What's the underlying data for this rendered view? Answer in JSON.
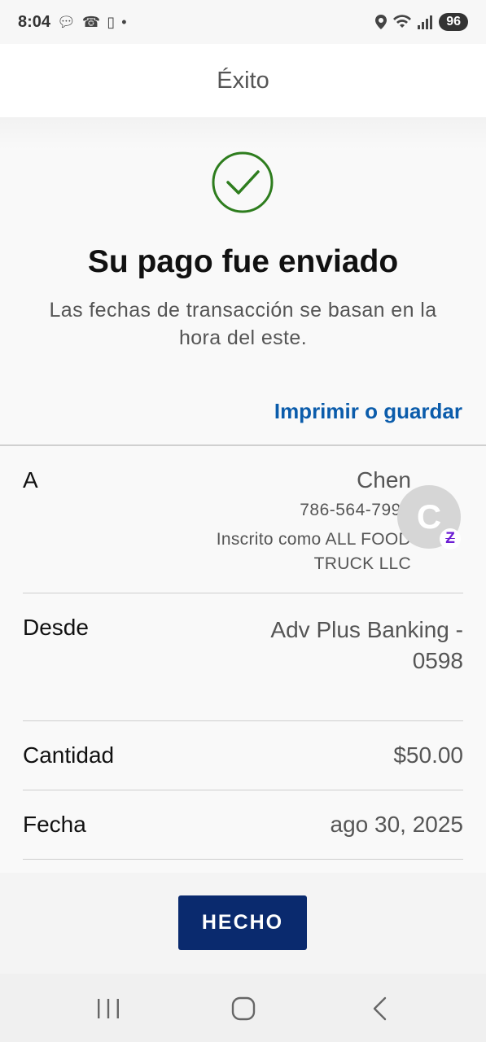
{
  "status_bar": {
    "time": "8:04",
    "battery": "96",
    "icons": [
      "messages-icon",
      "whatsapp-icon",
      "phone-icon",
      "dot-icon",
      "location-icon",
      "wifi-icon",
      "signal-icon"
    ]
  },
  "app_bar": {
    "title": "Éxito"
  },
  "confirmation": {
    "icon": "check-circle-icon",
    "headline": "Su pago fue enviado",
    "subtext": "Las fechas de transacción se basan en la hora del este.",
    "print_link": "Imprimir o guardar",
    "success_color": "#2e7d1e",
    "link_color": "#0b5cab"
  },
  "details": {
    "to": {
      "label": "A",
      "name": "Chen",
      "phone": "786-564-7994",
      "enrolled": "Inscrito como ALL FOOD TRUCK LLC",
      "avatar_initial": "C",
      "badge": "Z",
      "badge_icon": "zelle-icon"
    },
    "from": {
      "label": "Desde",
      "value": "Adv Plus Banking - 0598"
    },
    "amount": {
      "label": "Cantidad",
      "value": "$50.00"
    },
    "date": {
      "label": "Fecha",
      "value": "ago 30, 2025"
    }
  },
  "footer": {
    "done_label": "HECHO",
    "button_color": "#0a2a6e"
  },
  "nav_bar": {
    "icons": [
      "recent-apps-icon",
      "home-icon",
      "back-icon"
    ]
  }
}
